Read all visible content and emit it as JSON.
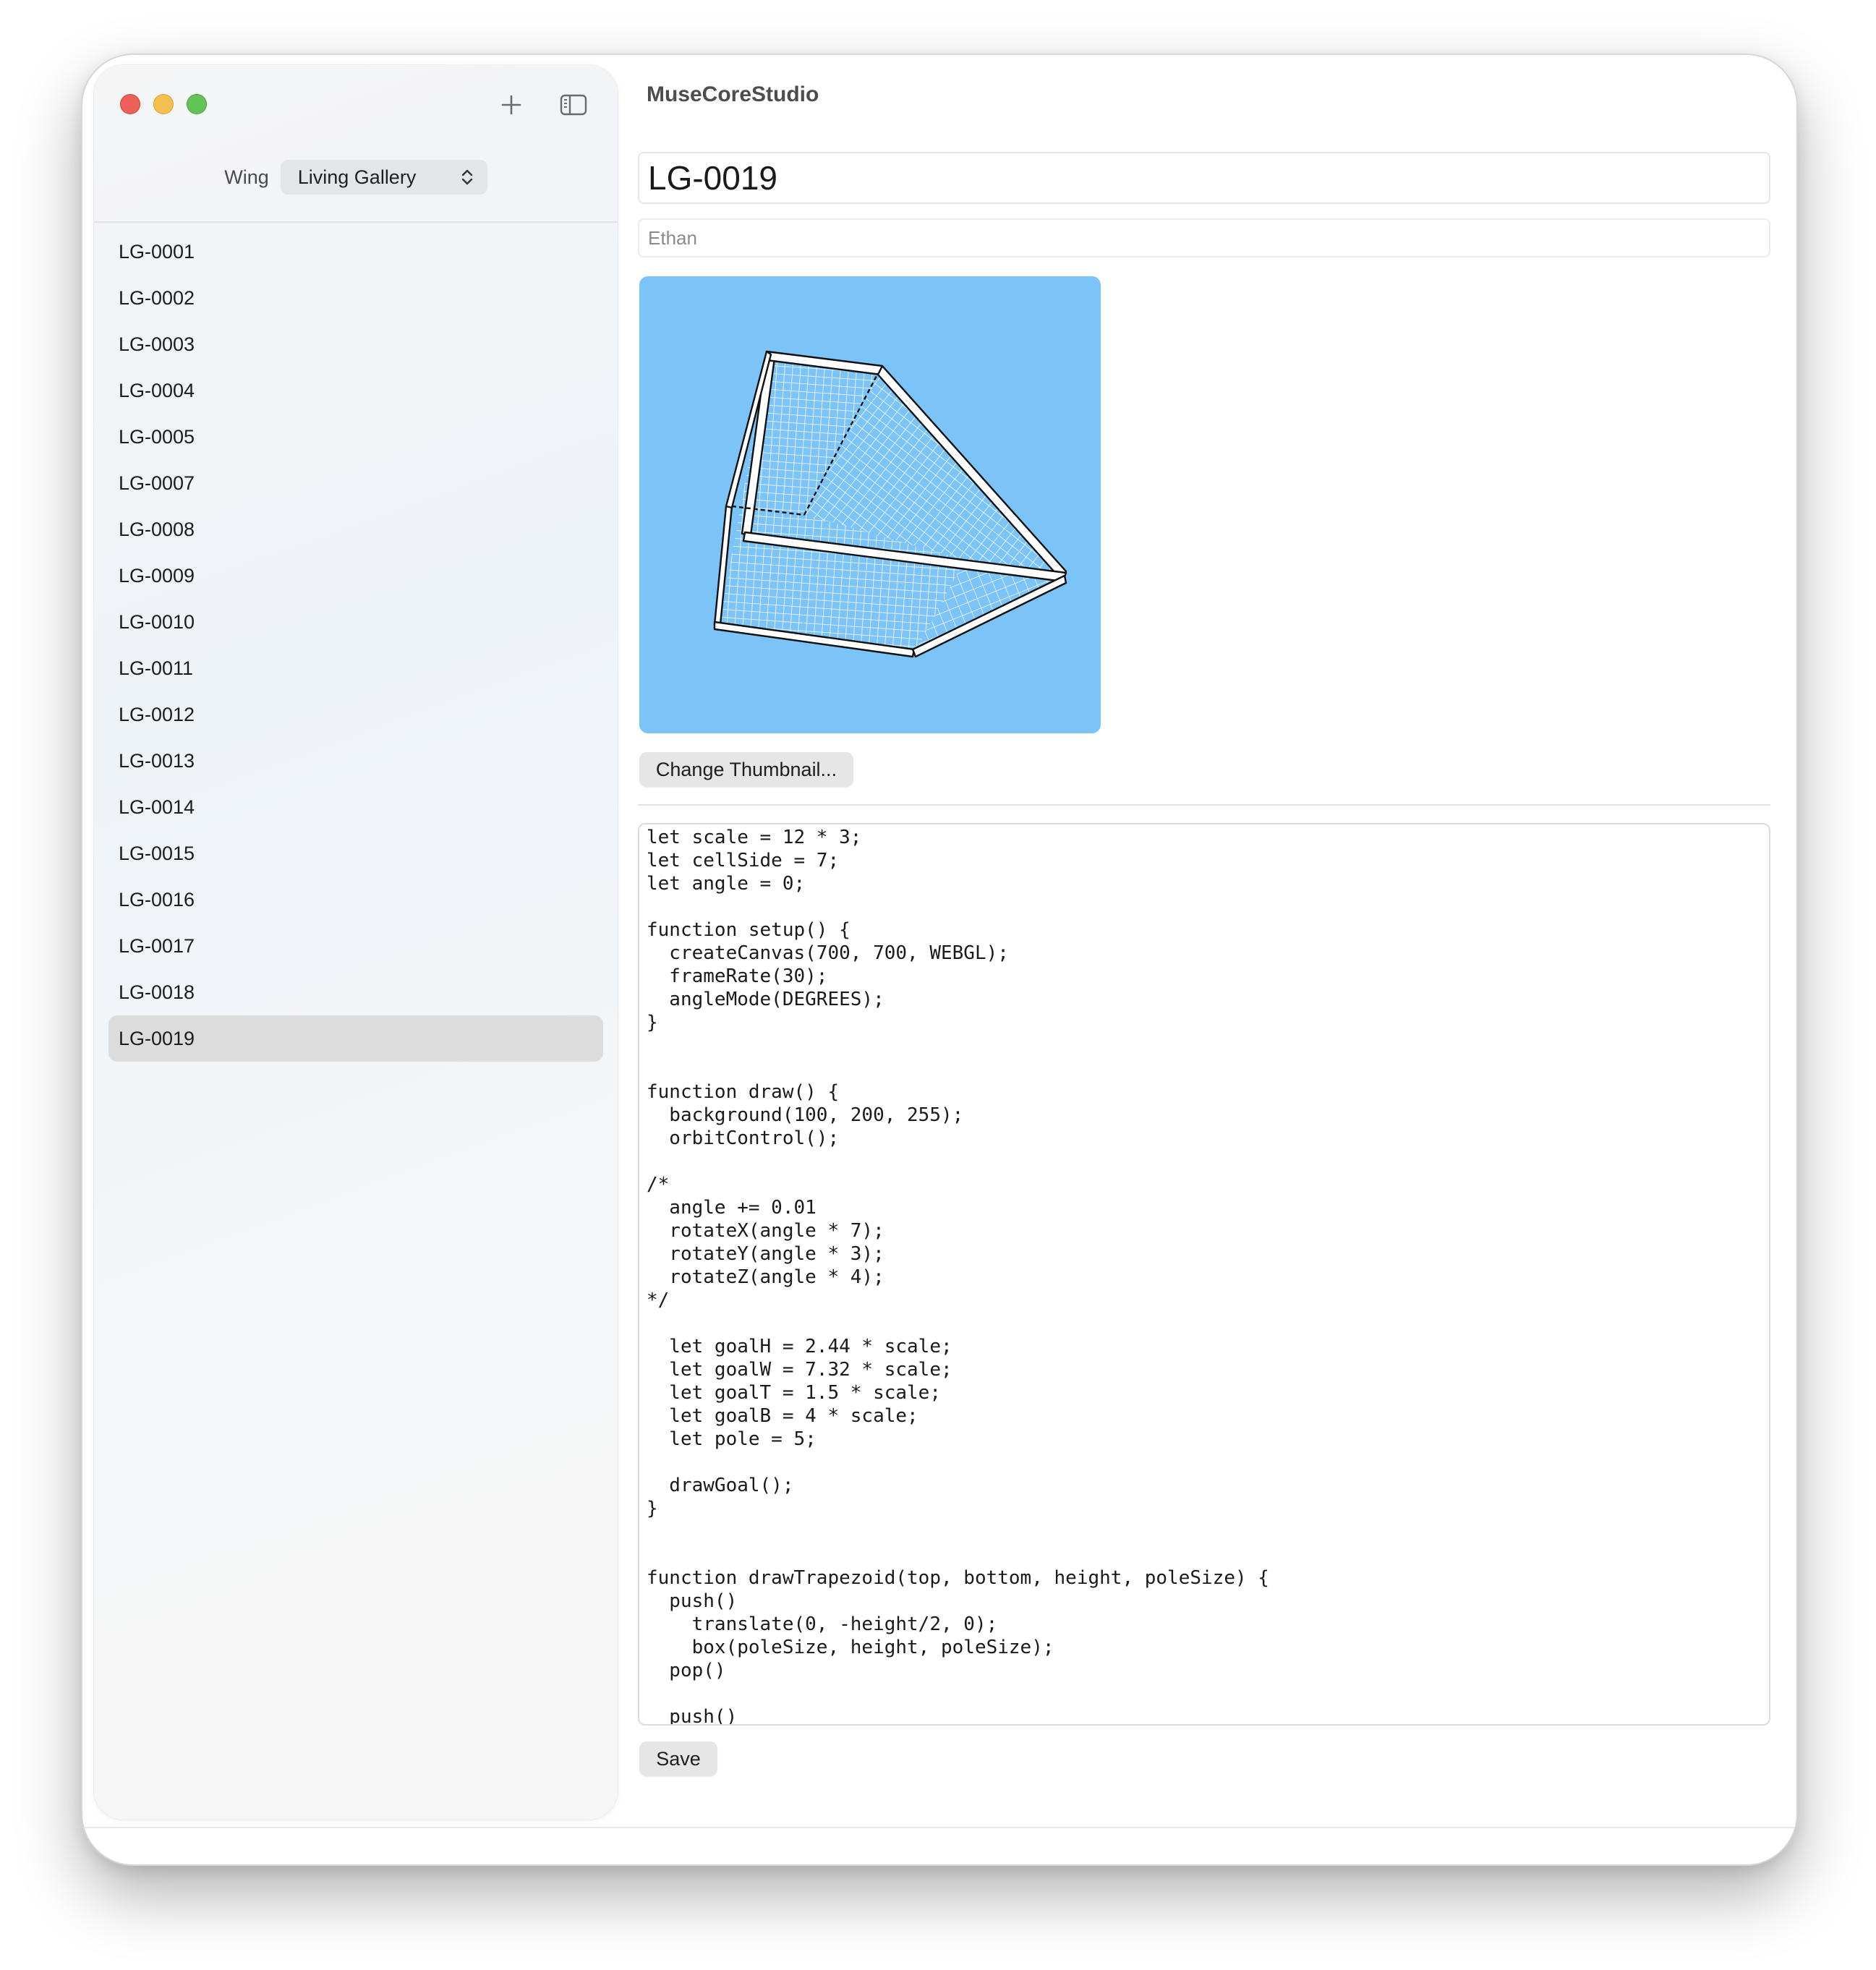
{
  "window": {
    "app_title": "MuseCoreStudio"
  },
  "sidebar": {
    "wing_label": "Wing",
    "wing_selected": "Living Gallery",
    "items": [
      {
        "label": "LG-0001",
        "selected": false
      },
      {
        "label": "LG-0002",
        "selected": false
      },
      {
        "label": "LG-0003",
        "selected": false
      },
      {
        "label": "LG-0004",
        "selected": false
      },
      {
        "label": "LG-0005",
        "selected": false
      },
      {
        "label": "LG-0007",
        "selected": false
      },
      {
        "label": "LG-0008",
        "selected": false
      },
      {
        "label": "LG-0009",
        "selected": false
      },
      {
        "label": "LG-0010",
        "selected": false
      },
      {
        "label": "LG-0011",
        "selected": false
      },
      {
        "label": "LG-0012",
        "selected": false
      },
      {
        "label": "LG-0013",
        "selected": false
      },
      {
        "label": "LG-0014",
        "selected": false
      },
      {
        "label": "LG-0015",
        "selected": false
      },
      {
        "label": "LG-0016",
        "selected": false
      },
      {
        "label": "LG-0017",
        "selected": false
      },
      {
        "label": "LG-0018",
        "selected": false
      },
      {
        "label": "LG-0019",
        "selected": true
      }
    ]
  },
  "icons": {
    "toolbar": [
      "plus-icon",
      "sidebar-toggle-icon"
    ],
    "select": "chevron-up-down-icon"
  },
  "detail": {
    "title_value": "LG-0019",
    "author_value": "Ethan",
    "change_thumbnail_label": "Change Thumbnail...",
    "save_label": "Save",
    "thumbnail_background": "#7cc4f8",
    "code_lines": [
      "let scale = 12 * 3;",
      "let cellSide = 7;",
      "let angle = 0;",
      "",
      "function setup() {",
      "  createCanvas(700, 700, WEBGL);",
      "  frameRate(30);",
      "  angleMode(DEGREES);",
      "}",
      "",
      "",
      "function draw() {",
      "  background(100, 200, 255);",
      "  orbitControl();",
      "",
      "/*",
      "  angle += 0.01",
      "  rotateX(angle * 7);",
      "  rotateY(angle * 3);",
      "  rotateZ(angle * 4);",
      "*/",
      "",
      "  let goalH = 2.44 * scale;",
      "  let goalW = 7.32 * scale;",
      "  let goalT = 1.5 * scale;",
      "  let goalB = 4 * scale;",
      "  let pole = 5;",
      "",
      "  drawGoal();",
      "}",
      "",
      "",
      "function drawTrapezoid(top, bottom, height, poleSize) {",
      "  push()",
      "    translate(0, -height/2, 0);",
      "    box(poleSize, height, poleSize);",
      "  pop()",
      "",
      "  push()"
    ]
  }
}
